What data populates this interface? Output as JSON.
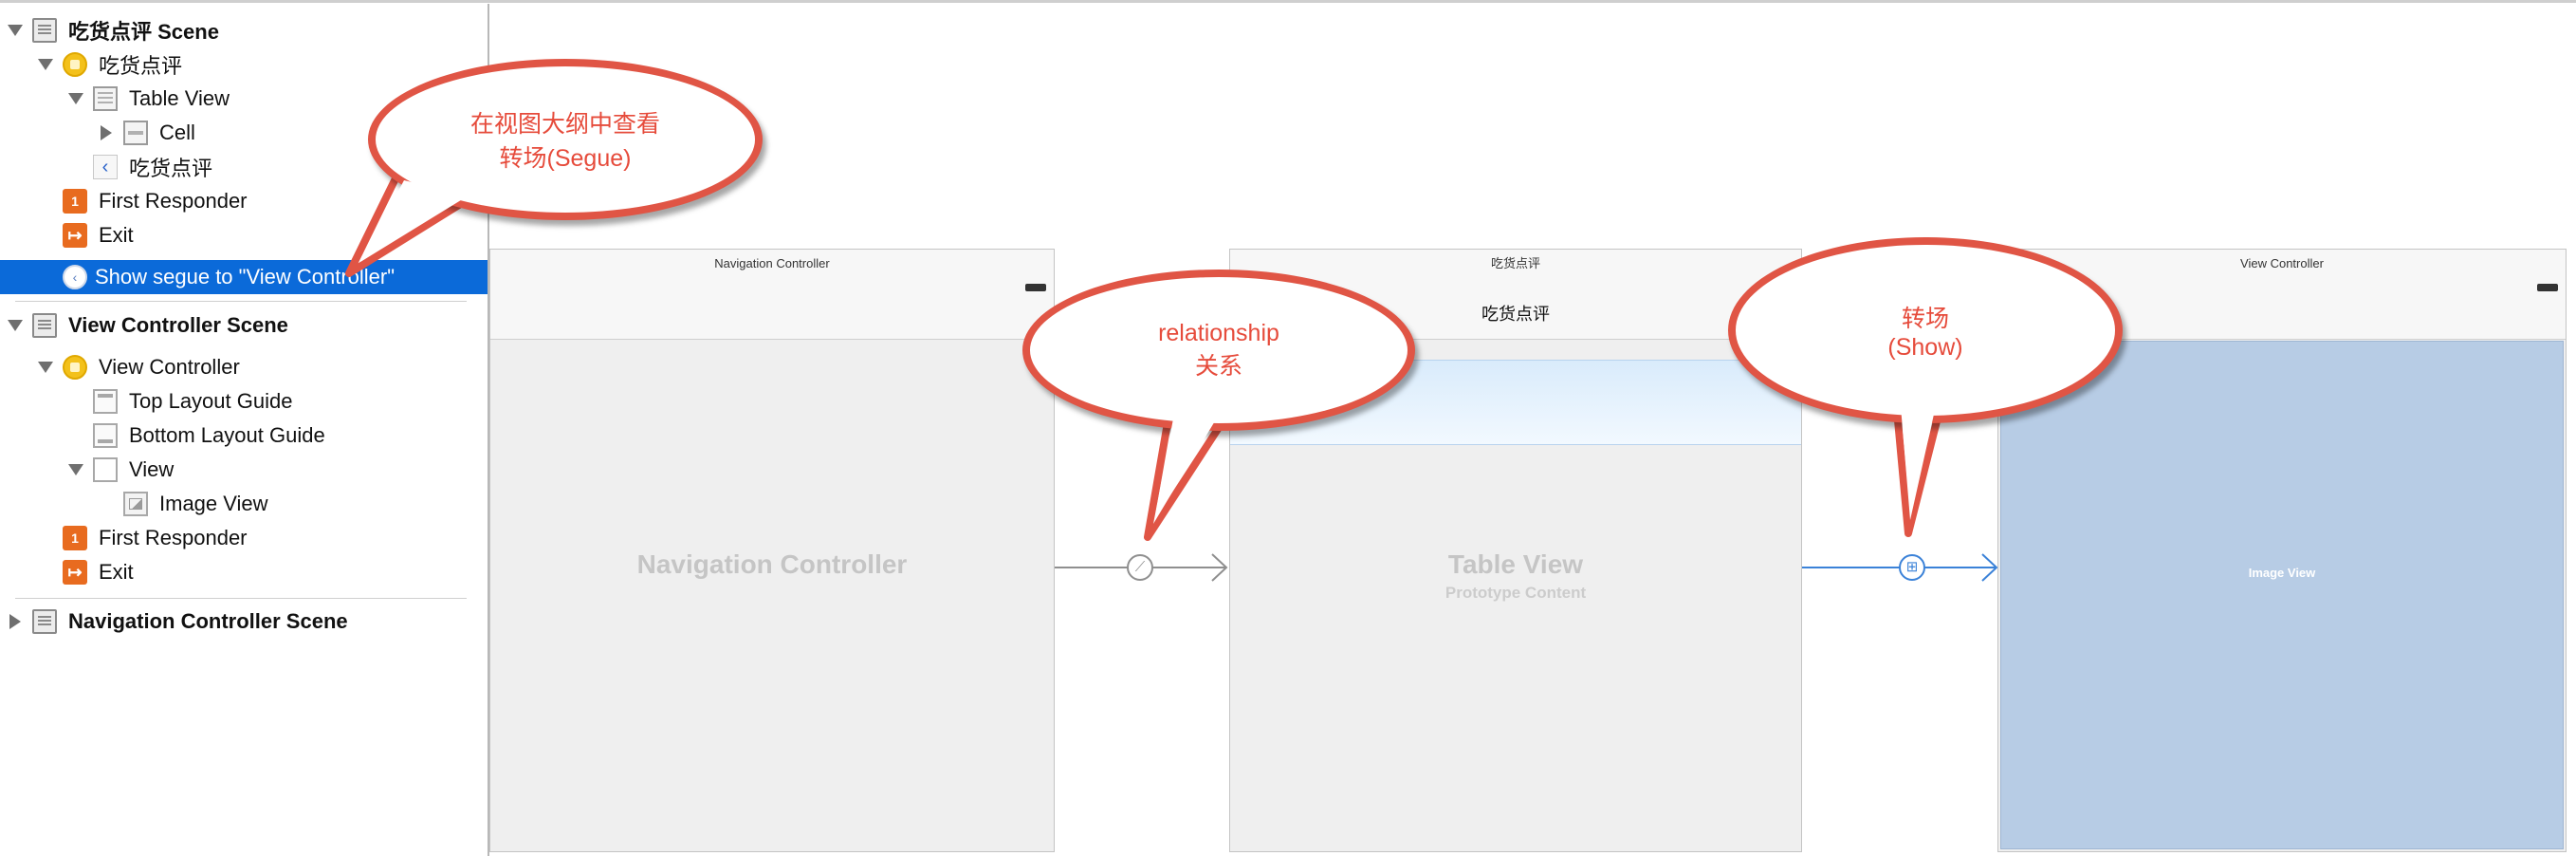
{
  "outline": {
    "scene1_title": "吃货点评 Scene",
    "vc1_label": "吃货点评",
    "table_view_label": "Table View",
    "cell_label": "Cell",
    "nav_item_label": "吃货点评",
    "first_responder1": "First Responder",
    "exit1": "Exit",
    "segue_label": "Show segue to \"View Controller\"",
    "scene2_title": "View Controller Scene",
    "vc2_label": "View Controller",
    "top_guide": "Top Layout Guide",
    "bottom_guide": "Bottom Layout Guide",
    "view_label": "View",
    "image_view_label": "Image View",
    "first_responder2": "First Responder",
    "exit2": "Exit",
    "scene3_title": "Navigation Controller Scene"
  },
  "canvas": {
    "nav_scene": {
      "title": "Navigation Controller",
      "body_label": "Navigation Controller"
    },
    "table_scene": {
      "title": "吃货点评",
      "nav_title": "吃货点评",
      "body_label": "Table View",
      "sub_label": "Prototype Content"
    },
    "vc_scene": {
      "title": "View Controller",
      "image_label": "Image View"
    }
  },
  "callouts": {
    "outline_note_line1": "在视图大纲中查看",
    "outline_note_line2": "转场(Segue)",
    "relationship_line1": "relationship",
    "relationship_line2": "关系",
    "show_line1": "转场",
    "show_line2": "(Show)"
  },
  "colors": {
    "selection": "#0b6ad9",
    "callout_border": "#e05545",
    "callout_text": "#e64b3b",
    "segue_show": "#3b82d8",
    "image_view_fill": "#b7cce5"
  },
  "icons": {
    "scene": "scene-icon",
    "view_controller": "view-controller-icon",
    "table_view": "table-view-icon",
    "cell": "cell-icon",
    "navigation_item": "navigation-item-icon",
    "first_responder": "first-responder-icon",
    "exit": "exit-icon",
    "segue": "segue-icon",
    "layout_guide": "layout-guide-icon",
    "view": "view-icon",
    "image_view": "image-view-icon",
    "relationship": "relationship-segue-icon",
    "show_segue": "show-segue-icon"
  }
}
